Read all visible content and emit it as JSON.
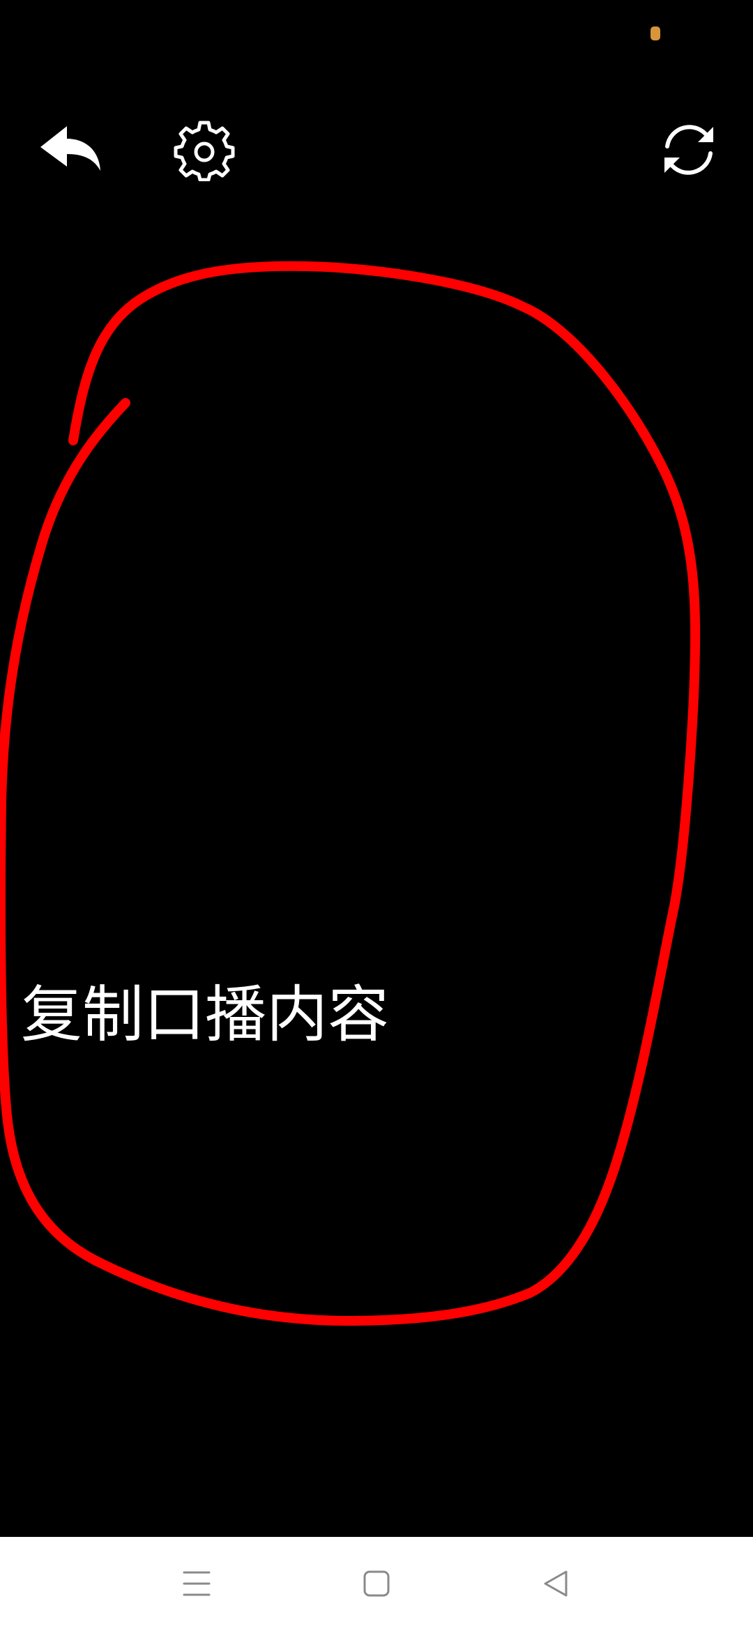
{
  "content": {
    "text": "复制口播内容"
  },
  "icons": {
    "back": "back-arrow-icon",
    "settings": "gear-icon",
    "refresh": "refresh-icon",
    "nav_menu": "menu-icon",
    "nav_home": "home-square-icon",
    "nav_back": "back-triangle-icon"
  },
  "colors": {
    "background": "#000000",
    "annotation": "#ff0000",
    "text": "#ffffff",
    "status_indicator": "#e0a040",
    "navbar": "#ffffff",
    "navbar_icon": "#8a8a8a"
  }
}
